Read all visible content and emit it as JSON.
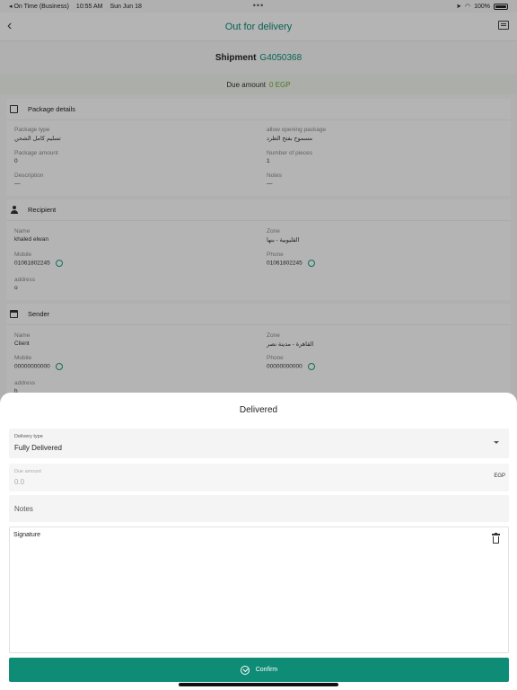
{
  "status_bar": {
    "carrier": "◂ On Time (Business)",
    "time": "10:55 AM",
    "date": "Sun Jun 18",
    "battery": "100%"
  },
  "header": {
    "title": "Out for delivery",
    "back_icon": "chevron-left-icon",
    "chat_icon": "message-icon"
  },
  "shipment": {
    "label": "Shipment",
    "number": "G4050368"
  },
  "due": {
    "label": "Due amount",
    "value": "0 EGP"
  },
  "package": {
    "title": "Package details",
    "type_label": "Package type",
    "type_value": "تسليم كامل الشحن",
    "opening_label": "allow opening package",
    "opening_value": "مسموح بفتح الطرد",
    "amount_label": "Package amount",
    "amount_value": "0",
    "pieces_label": "Number of pieces",
    "pieces_value": "1",
    "desc_label": "Description",
    "desc_value": "—",
    "notes_label": "Notes",
    "notes_value": "—"
  },
  "recipient": {
    "title": "Recipient",
    "name_label": "Name",
    "name_value": "khaled elwan",
    "zone_label": "Zone",
    "zone_value": "القليوبية - بنها",
    "mobile_label": "Mobile",
    "mobile_value": "01061802245",
    "phone_label": "Phone",
    "phone_value": "01061802245",
    "address_label": "address",
    "address_value": "o"
  },
  "sender": {
    "title": "Sender",
    "name_label": "Name",
    "name_value": "Client",
    "zone_label": "Zone",
    "zone_value": "القاهرة - مدينة نصر",
    "mobile_label": "Mobile",
    "mobile_value": "00000000000",
    "phone_label": "Phone",
    "phone_value": "00000000000",
    "address_label": "address",
    "address_value": "h"
  },
  "sheet": {
    "title": "Delivered",
    "delivery_type_label": "Delivery type",
    "delivery_type_value": "Fully Delivered",
    "due_label": "Due amount",
    "due_value": "0.0",
    "due_unit": "EGP",
    "notes_placeholder": "Notes",
    "signature_label": "Signature",
    "confirm_label": "Confirm"
  },
  "colors": {
    "accent": "#0f8c76",
    "due_value": "#6aa62a"
  }
}
